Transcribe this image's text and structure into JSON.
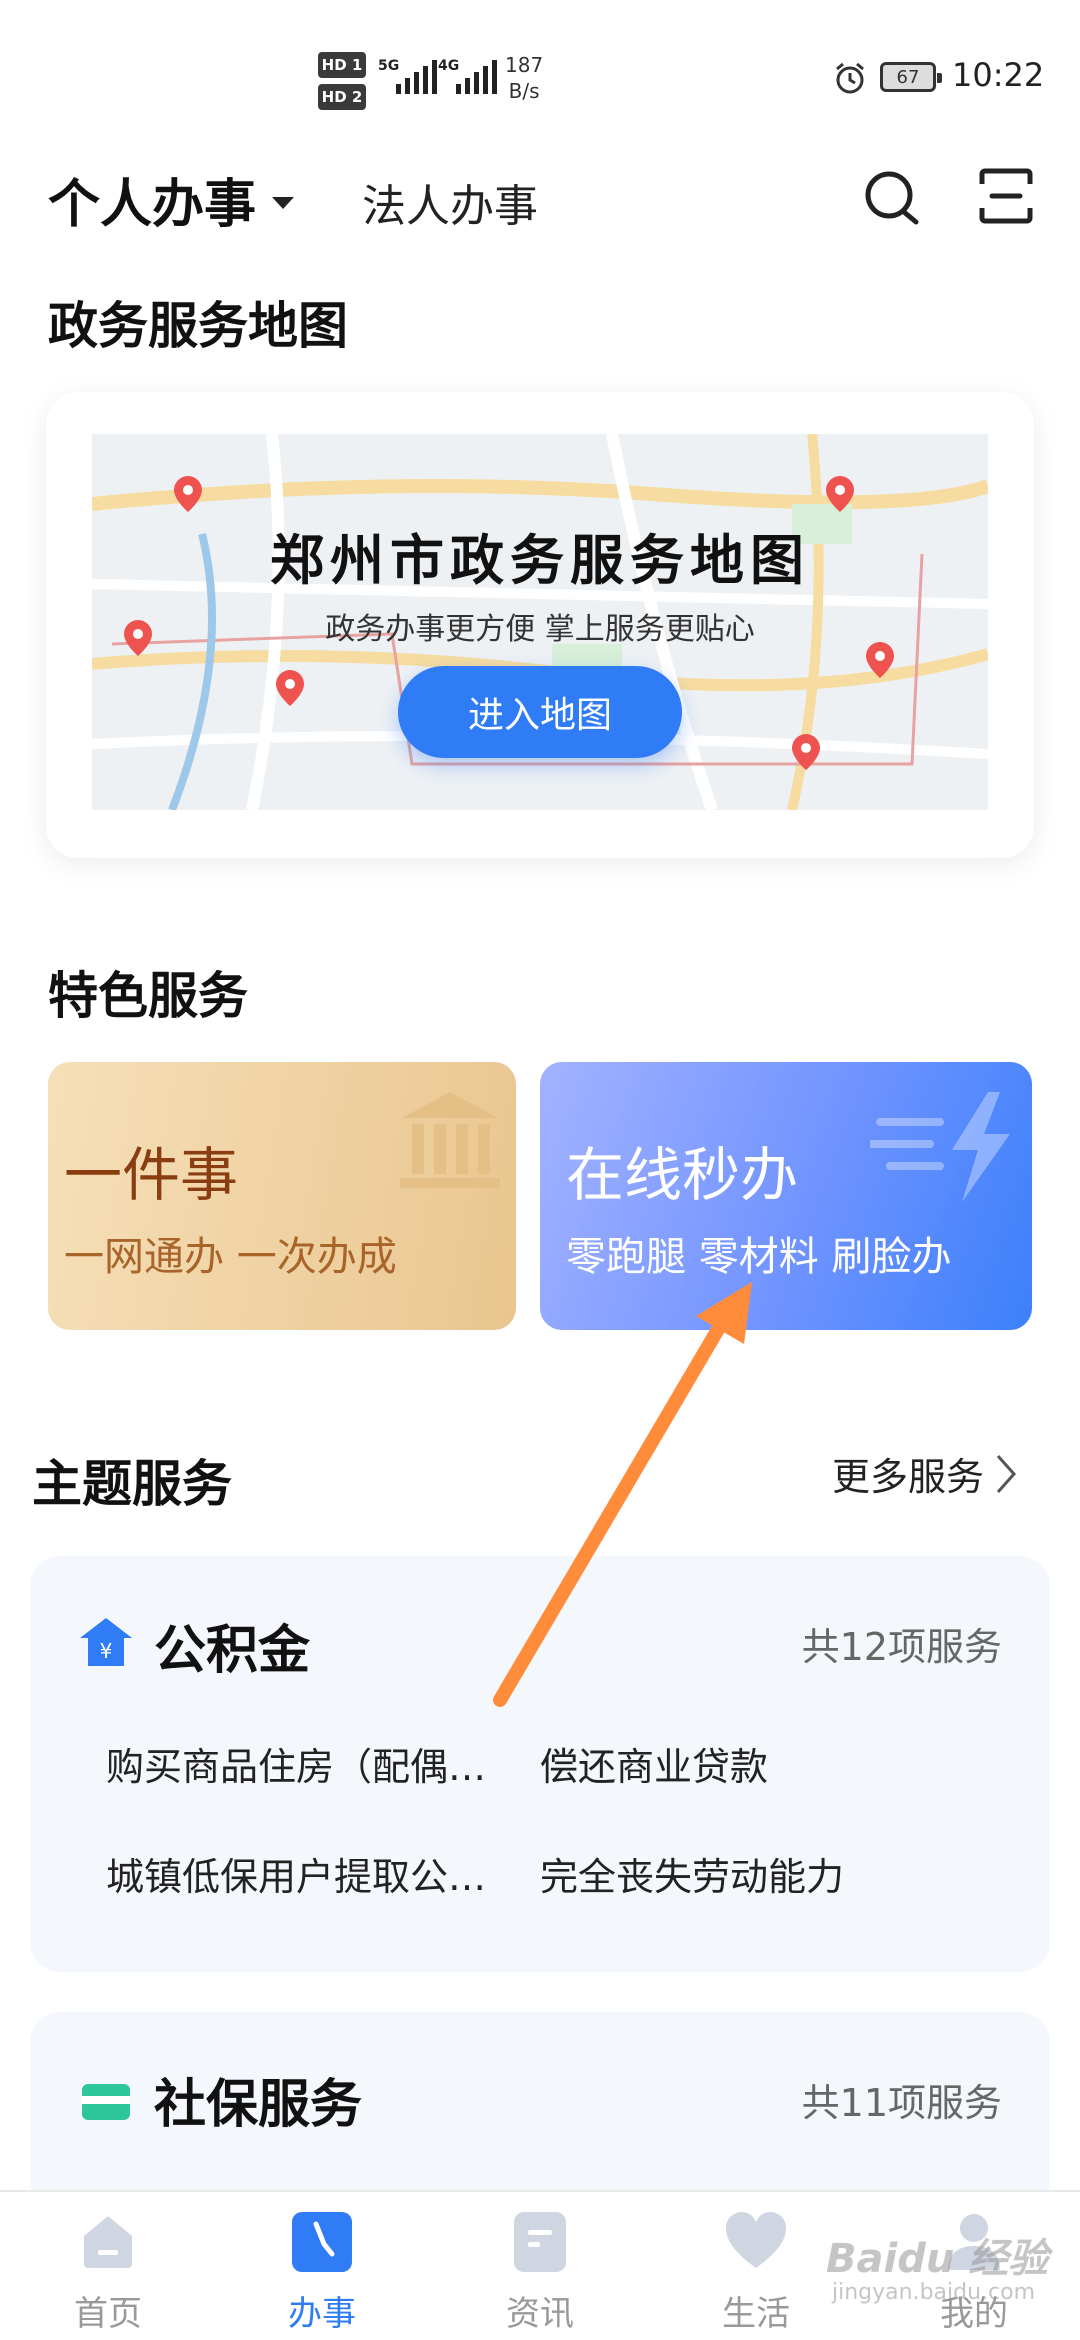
{
  "status_bar": {
    "sim1": "HD 1",
    "sim2": "HD 2",
    "net1": "5G",
    "net2": "4G",
    "speed_value": "187",
    "speed_unit": "B/s",
    "battery": "67",
    "time": "10:22"
  },
  "top_nav": {
    "personal_tab": "个人办事",
    "legal_tab": "法人办事"
  },
  "map_section": {
    "title": "政务服务地图",
    "card_title": "郑州市政务服务地图",
    "card_subtitle": "政务办事更方便  掌上服务更贴心",
    "button": "进入地图"
  },
  "featured": {
    "title": "特色服务",
    "cards": [
      {
        "title": "一件事",
        "subtitle": "一网通办 一次办成"
      },
      {
        "title": "在线秒办",
        "subtitle": "零跑腿 零材料 刷脸办"
      }
    ]
  },
  "theme": {
    "title": "主题服务",
    "more": "更多服务",
    "cards": [
      {
        "icon": "housing-fund-icon",
        "title": "公积金",
        "count": "共12项服务",
        "items": [
          "购买商品住房（配偶…",
          "偿还商业贷款",
          "城镇低保用户提取公…",
          "完全丧失劳动能力"
        ]
      },
      {
        "icon": "social-security-icon",
        "title": "社保服务",
        "count": "共11项服务",
        "items": []
      }
    ]
  },
  "bottom_nav": [
    {
      "label": "首页",
      "icon": "home-icon",
      "active": false
    },
    {
      "label": "办事",
      "icon": "clock-icon",
      "active": true
    },
    {
      "label": "资讯",
      "icon": "news-icon",
      "active": false
    },
    {
      "label": "生活",
      "icon": "heart-icon",
      "active": false
    },
    {
      "label": "我的",
      "icon": "profile-icon",
      "active": false
    }
  ],
  "watermark": {
    "text": "Baidu 经验",
    "sub": "jingyan.baidu.com"
  },
  "colors": {
    "accent": "#2f7cf6",
    "arrow": "#ff8c3a",
    "gold_title": "#8a3d10",
    "muted": "#999999"
  }
}
